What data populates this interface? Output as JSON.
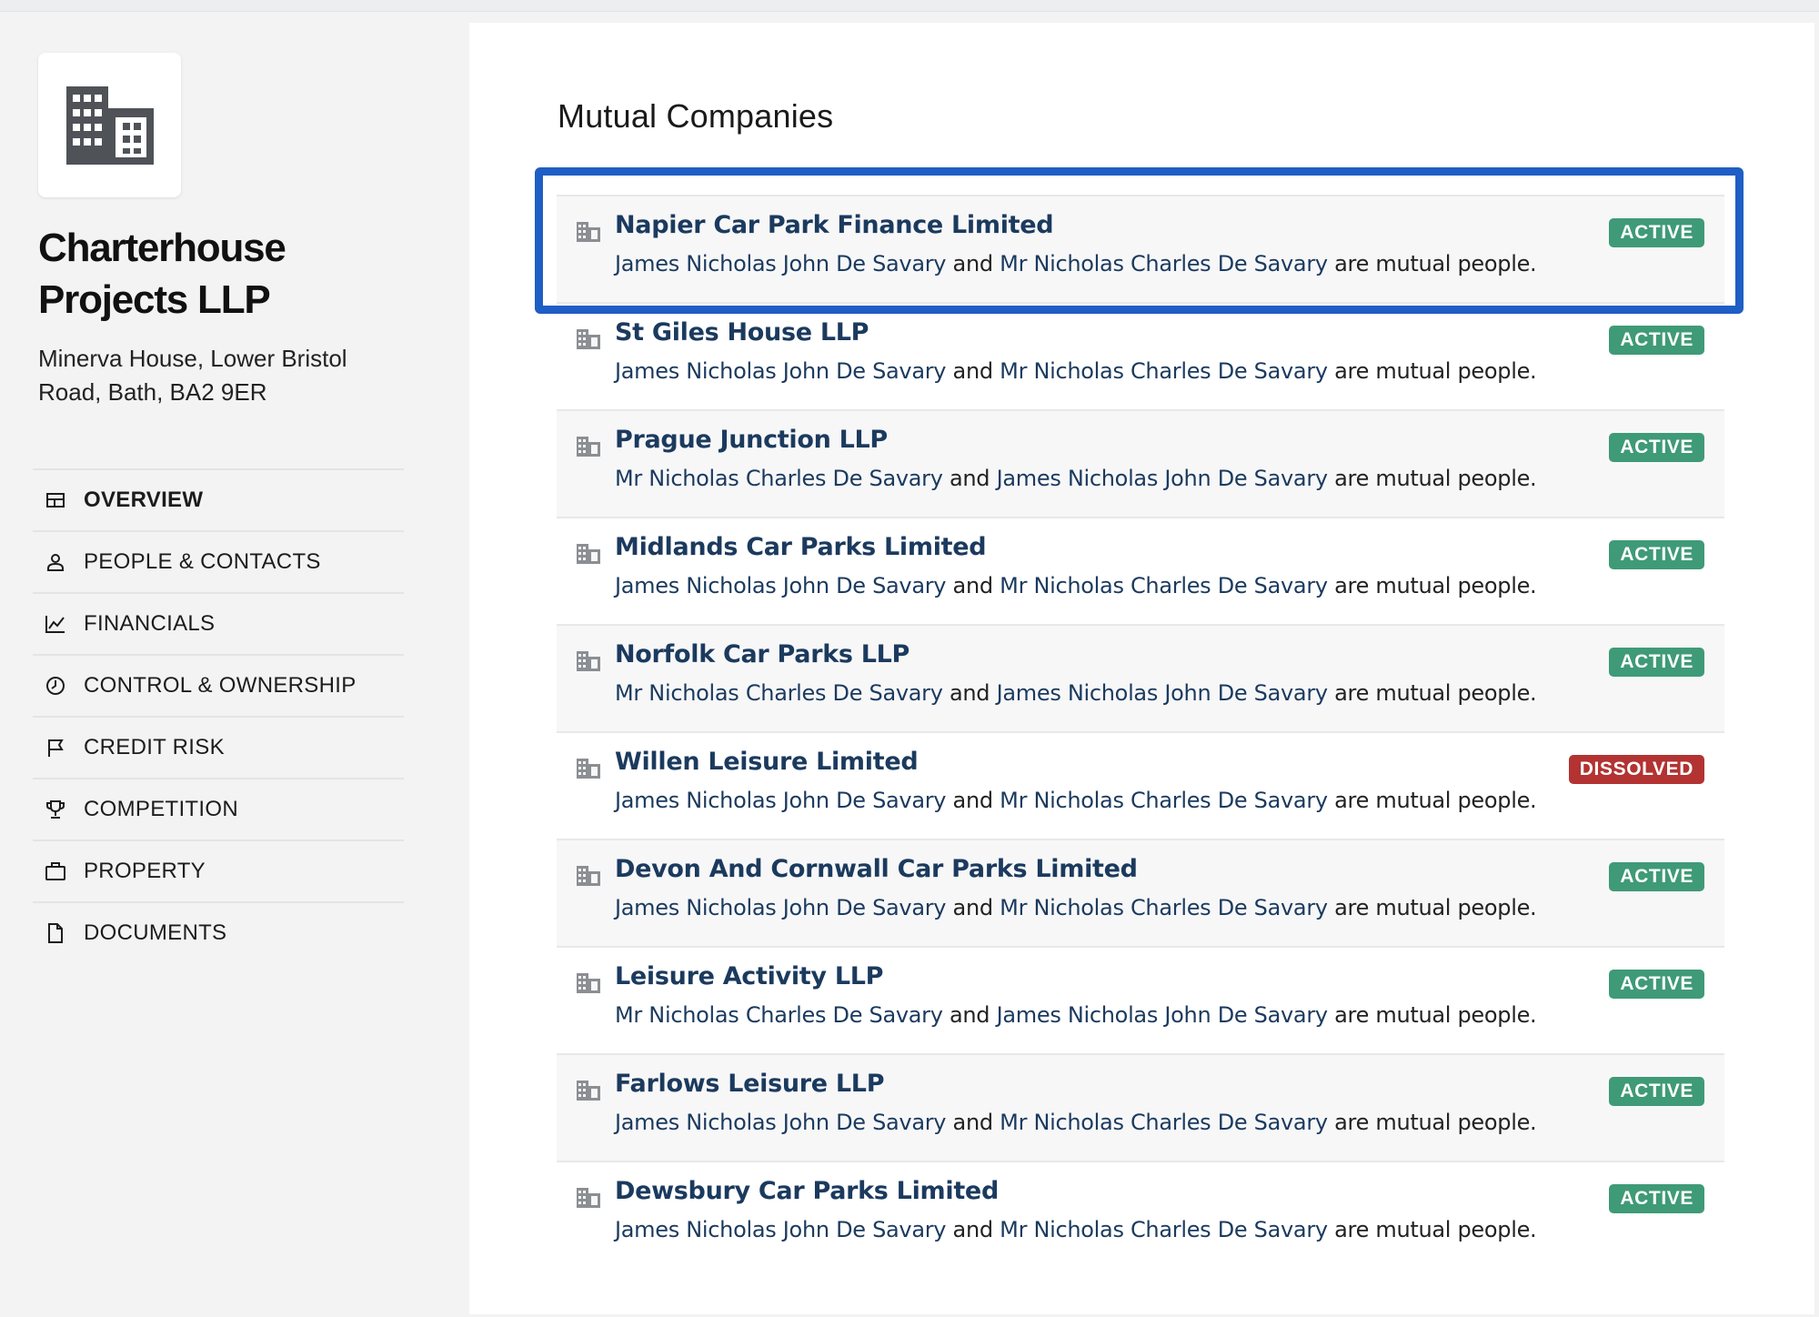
{
  "company": {
    "name": "Charterhouse Projects LLP",
    "address": "Minerva House, Lower Bristol Road, Bath, BA2 9ER",
    "logo_icon": "building-icon"
  },
  "nav": {
    "items": [
      {
        "label": "OVERVIEW",
        "icon": "overview-icon",
        "active": true
      },
      {
        "label": "PEOPLE & CONTACTS",
        "icon": "person-icon"
      },
      {
        "label": "FINANCIALS",
        "icon": "chart-line-icon"
      },
      {
        "label": "CONTROL & OWNERSHIP",
        "icon": "clock-icon"
      },
      {
        "label": "CREDIT RISK",
        "icon": "flag-icon"
      },
      {
        "label": "COMPETITION",
        "icon": "trophy-icon"
      },
      {
        "label": "PROPERTY",
        "icon": "briefcase-icon"
      },
      {
        "label": "DOCUMENTS",
        "icon": "document-icon"
      }
    ]
  },
  "main": {
    "title": "Mutual Companies",
    "connector": "and",
    "suffix": "are mutual people.",
    "companies": [
      {
        "name": "Napier Car Park Finance Limited",
        "person1": "James Nicholas John De Savary",
        "person2": "Mr Nicholas Charles De Savary",
        "status": "ACTIVE"
      },
      {
        "name": "St Giles House LLP",
        "person1": "James Nicholas John De Savary",
        "person2": "Mr Nicholas Charles De Savary",
        "status": "ACTIVE"
      },
      {
        "name": "Prague Junction LLP",
        "person1": "Mr Nicholas Charles De Savary",
        "person2": "James Nicholas John De Savary",
        "status": "ACTIVE"
      },
      {
        "name": "Midlands Car Parks Limited",
        "person1": "James Nicholas John De Savary",
        "person2": "Mr Nicholas Charles De Savary",
        "status": "ACTIVE"
      },
      {
        "name": "Norfolk Car Parks LLP",
        "person1": "Mr Nicholas Charles De Savary",
        "person2": "James Nicholas John De Savary",
        "status": "ACTIVE"
      },
      {
        "name": "Willen Leisure Limited",
        "person1": "James Nicholas John De Savary",
        "person2": "Mr Nicholas Charles De Savary",
        "status": "DISSOLVED"
      },
      {
        "name": "Devon And Cornwall Car Parks Limited",
        "person1": "James Nicholas John De Savary",
        "person2": "Mr Nicholas Charles De Savary",
        "status": "ACTIVE"
      },
      {
        "name": "Leisure Activity LLP",
        "person1": "Mr Nicholas Charles De Savary",
        "person2": "James Nicholas John De Savary",
        "status": "ACTIVE"
      },
      {
        "name": "Farlows Leisure LLP",
        "person1": "James Nicholas John De Savary",
        "person2": "Mr Nicholas Charles De Savary",
        "status": "ACTIVE"
      },
      {
        "name": "Dewsbury Car Parks Limited",
        "person1": "James Nicholas John De Savary",
        "person2": "Mr Nicholas Charles De Savary",
        "status": "ACTIVE"
      }
    ]
  },
  "colors": {
    "link": "#1b3a5e",
    "active_badge": "#3f9a77",
    "dissolved_badge": "#b23332",
    "highlight": "#1f5ec4"
  }
}
